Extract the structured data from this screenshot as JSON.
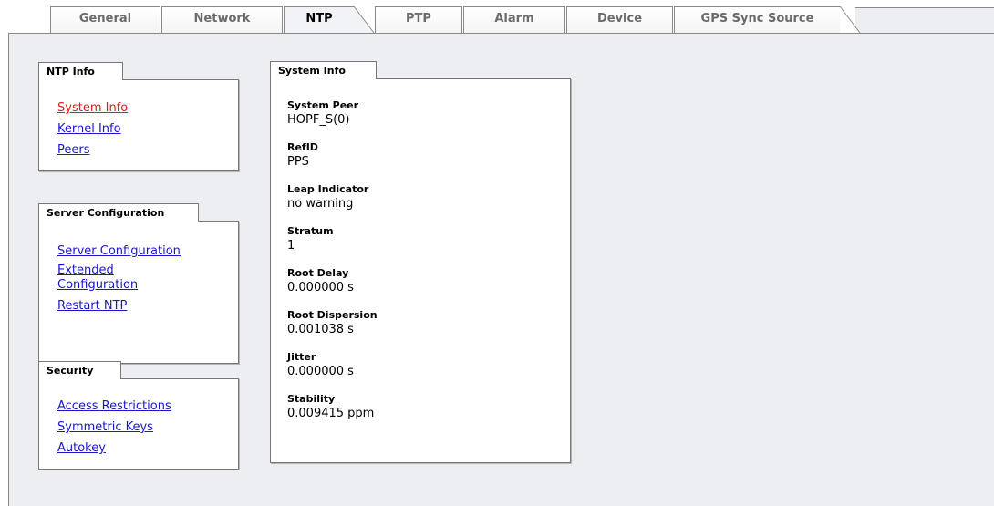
{
  "tabs": [
    {
      "label": "General"
    },
    {
      "label": "Network"
    },
    {
      "label": "NTP"
    },
    {
      "label": "PTP"
    },
    {
      "label": "Alarm"
    },
    {
      "label": "Device"
    },
    {
      "label": "GPS Sync Source"
    }
  ],
  "active_tab": "NTP",
  "sidebar": {
    "ntp_info": {
      "title": "NTP Info",
      "links": [
        "System Info",
        "Kernel Info",
        "Peers"
      ]
    },
    "server_configuration": {
      "title": "Server Configuration",
      "links": [
        "Server Configuration",
        "Extended Configuration",
        "Restart NTP"
      ]
    },
    "security": {
      "title": "Security",
      "links": [
        "Access Restrictions",
        "Symmetric Keys",
        "Autokey"
      ]
    }
  },
  "system_info": {
    "title": "System Info",
    "fields": [
      {
        "label": "System Peer",
        "value": "HOPF_S(0)"
      },
      {
        "label": "RefID",
        "value": "PPS"
      },
      {
        "label": "Leap Indicator",
        "value": "no warning"
      },
      {
        "label": "Stratum",
        "value": "1"
      },
      {
        "label": "Root Delay",
        "value": "0.000000 s"
      },
      {
        "label": "Root Dispersion",
        "value": "0.001038 s"
      },
      {
        "label": "Jitter",
        "value": "0.000000 s"
      },
      {
        "label": "Stability",
        "value": "0.009415 ppm"
      }
    ]
  },
  "colors": {
    "link": "#1a17c9",
    "active_link": "#e31a1a",
    "panel_bg": "#eceef2",
    "tab_inactive_text": "#6b6b6b"
  }
}
